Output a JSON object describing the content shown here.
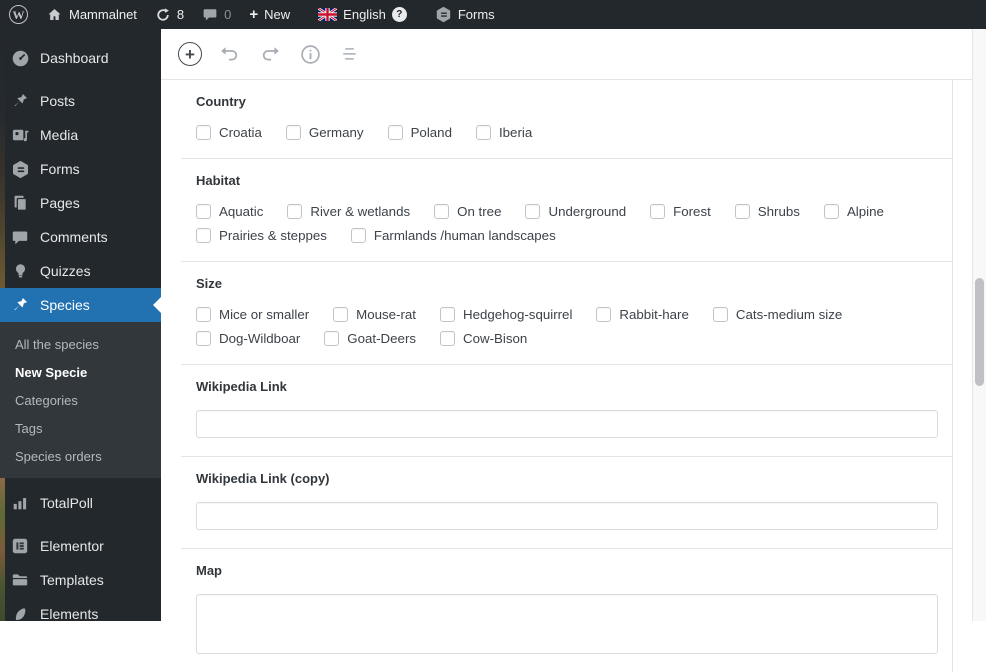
{
  "colors": {
    "accent_blue": "#2271b1",
    "admin_bar_bg": "#23282d",
    "submenu_bg": "#32373c",
    "content_bg": "#ffffff"
  },
  "admin_bar": {
    "site_name": "Mammalnet",
    "updates_count": "8",
    "comments_count": "0",
    "new_label": "New",
    "plus_glyph": "+",
    "language_label": "English",
    "help_badge": "?",
    "forms_label": "Forms",
    "wp_logo_glyph": "W"
  },
  "sidebar": {
    "items": [
      {
        "label": "Dashboard"
      },
      {
        "label": "Posts"
      },
      {
        "label": "Media"
      },
      {
        "label": "Forms"
      },
      {
        "label": "Pages"
      },
      {
        "label": "Comments"
      },
      {
        "label": "Quizzes"
      },
      {
        "label": "Species",
        "active": true
      },
      {
        "label": "TotalPoll"
      },
      {
        "label": "Elementor"
      },
      {
        "label": "Templates"
      },
      {
        "label": "Elements"
      }
    ],
    "species_submenu": [
      {
        "label": "All the species"
      },
      {
        "label": "New Specie",
        "current": true
      },
      {
        "label": "Categories"
      },
      {
        "label": "Tags"
      },
      {
        "label": "Species orders"
      }
    ]
  },
  "editor_toolbar": {
    "inserter_glyph": "+"
  },
  "form": {
    "sections": [
      {
        "type": "checkboxes",
        "label": "Country",
        "options": [
          "Croatia",
          "Germany",
          "Poland",
          "Iberia"
        ]
      },
      {
        "type": "checkboxes",
        "label": "Habitat",
        "options": [
          "Aquatic",
          "River & wetlands",
          "On tree",
          "Underground",
          "Forest",
          "Shrubs",
          "Alpine",
          "Prairies & steppes",
          "Farmlands /human landscapes"
        ]
      },
      {
        "type": "checkboxes",
        "label": "Size",
        "options": [
          "Mice or smaller",
          "Mouse-rat",
          "Hedgehog-squirrel",
          "Rabbit-hare",
          "Cats-medium size",
          "Dog-Wildboar",
          "Goat-Deers",
          "Cow-Bison"
        ]
      },
      {
        "type": "text",
        "label": "Wikipedia Link",
        "value": ""
      },
      {
        "type": "text",
        "label": "Wikipedia Link (copy)",
        "value": ""
      },
      {
        "type": "text",
        "label": "Map",
        "value": ""
      }
    ]
  }
}
